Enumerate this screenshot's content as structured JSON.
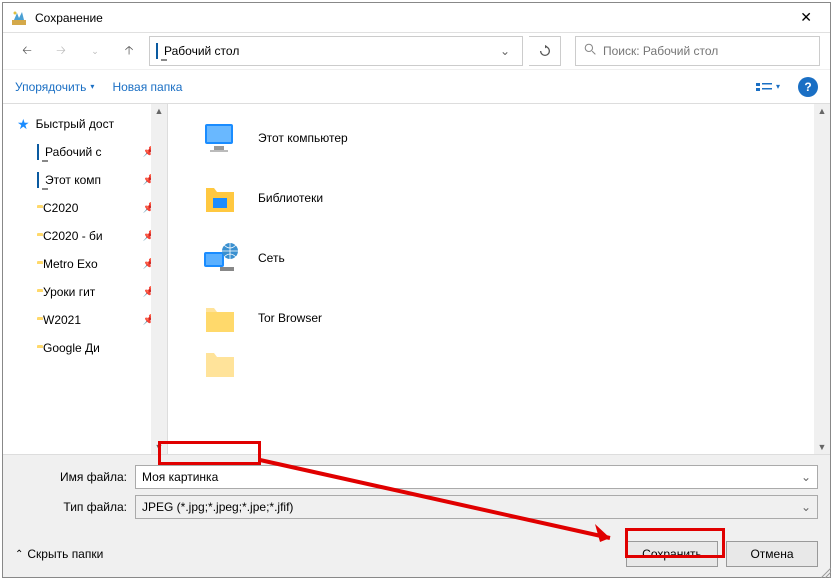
{
  "window": {
    "title": "Сохранение"
  },
  "nav": {
    "path_text": "Рабочий стол",
    "search_placeholder": "Поиск: Рабочий стол"
  },
  "toolbar": {
    "organize": "Упорядочить",
    "new_folder": "Новая папка"
  },
  "sidebar": {
    "quick_access": "Быстрый дост",
    "items": [
      {
        "label": "Рабочий с"
      },
      {
        "label": "Этот комп"
      },
      {
        "label": "C2020"
      },
      {
        "label": "C2020 - би"
      },
      {
        "label": "Metro Exo"
      },
      {
        "label": "Уроки гит"
      },
      {
        "label": "W2021"
      },
      {
        "label": "Google Ди"
      }
    ]
  },
  "content": {
    "items": [
      {
        "label": "Этот компьютер"
      },
      {
        "label": "Библиотеки"
      },
      {
        "label": "Сеть"
      },
      {
        "label": "Tor Browser"
      }
    ]
  },
  "form": {
    "filename_label": "Имя файла:",
    "filename_value": "Моя картинка",
    "filetype_label": "Тип файла:",
    "filetype_value": "JPEG (*.jpg;*.jpeg;*.jpe;*.jfif)"
  },
  "buttons": {
    "hide_folders": "Скрыть папки",
    "save": "Сохранить",
    "cancel": "Отмена"
  }
}
